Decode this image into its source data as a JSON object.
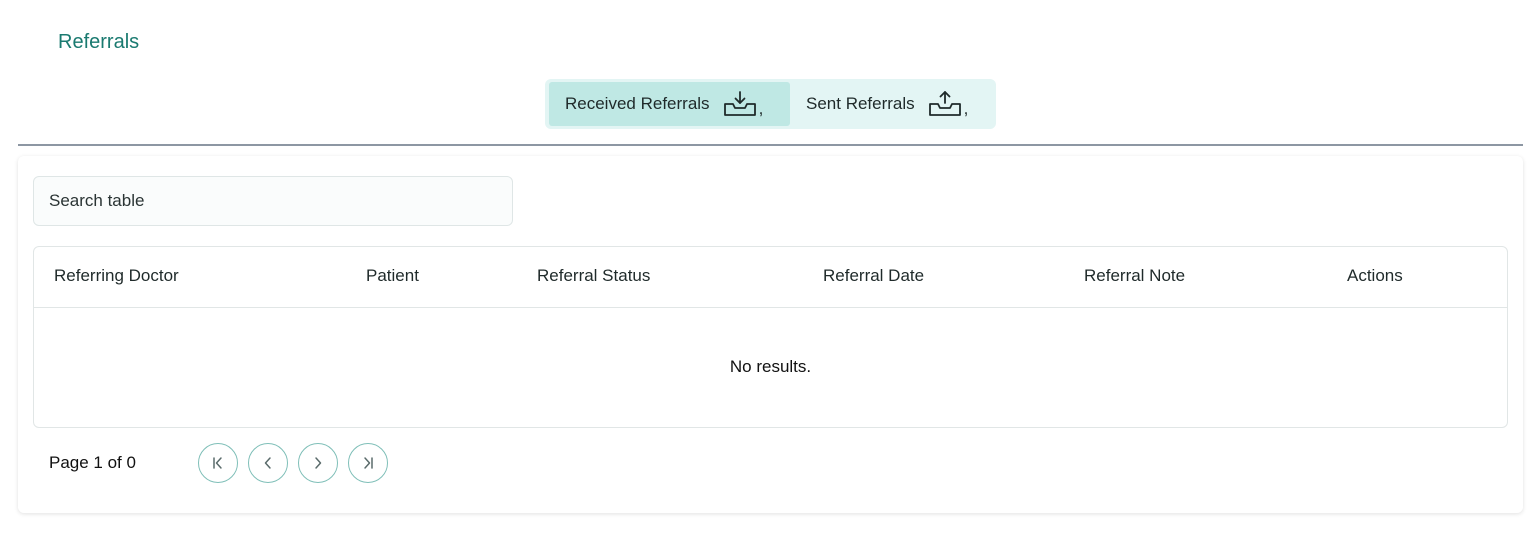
{
  "header": {
    "title": "Referrals"
  },
  "tabs": [
    {
      "label": "Received Referrals",
      "icon": "inbox-download-icon",
      "suffix": ",",
      "active": true
    },
    {
      "label": "Sent Referrals",
      "icon": "inbox-upload-icon",
      "suffix": ",",
      "active": false
    }
  ],
  "search": {
    "placeholder": "Search table",
    "value": ""
  },
  "table": {
    "columns": [
      "Referring Doctor",
      "Patient",
      "Referral Status",
      "Referral Date",
      "Referral Note",
      "Actions"
    ],
    "rows": [],
    "empty_text": "No results."
  },
  "pagination": {
    "label": "Page 1 of 0",
    "buttons": [
      "first-page-icon",
      "previous-page-icon",
      "next-page-icon",
      "last-page-icon"
    ]
  },
  "colors": {
    "accent": "#1a7a70",
    "tab_bg": "#e3f5f4",
    "tab_active_bg": "#bfe8e4",
    "pager_border": "#7fbfb8"
  }
}
